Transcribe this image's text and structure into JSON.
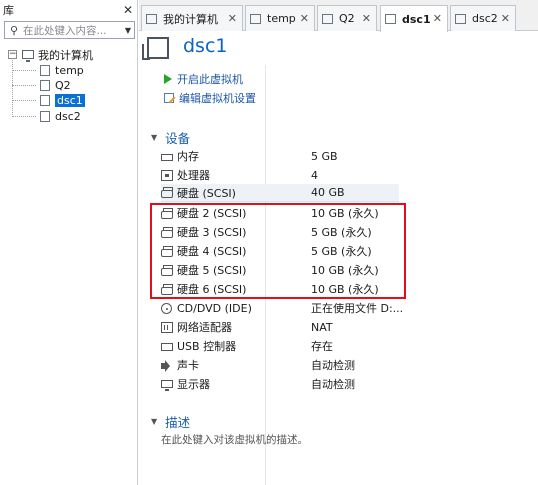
{
  "library": {
    "title": "库",
    "close": "✕",
    "search_placeholder": "在此处键入内容...",
    "tree": {
      "root": "我的计算机",
      "root_toggle": "⊟",
      "items": [
        {
          "label": "temp"
        },
        {
          "label": "Q2"
        },
        {
          "label": "dsc1",
          "selected": true
        },
        {
          "label": "dsc2"
        }
      ]
    }
  },
  "tabs": [
    {
      "label": "我的计算机",
      "active": false
    },
    {
      "label": "temp",
      "active": false
    },
    {
      "label": "Q2",
      "active": false
    },
    {
      "label": "dsc1",
      "active": true
    },
    {
      "label": "dsc2",
      "active": false
    }
  ],
  "tab_close": "✕",
  "vm": {
    "title": "dsc1",
    "actions": {
      "power_on": "开启此虚拟机",
      "edit_settings": "编辑虚拟机设置"
    }
  },
  "devices": {
    "section_title": "设备",
    "rows": [
      {
        "name": "内存",
        "value": "5 GB",
        "icon": "memory-icon"
      },
      {
        "name": "处理器",
        "value": "4",
        "icon": "processor-icon"
      },
      {
        "name": "硬盘 (SCSI)",
        "value": "40 GB",
        "icon": "hard-disk-icon"
      },
      {
        "name": "硬盘 2 (SCSI)",
        "value": "10 GB (永久)",
        "icon": "hard-disk-icon"
      },
      {
        "name": "硬盘 3 (SCSI)",
        "value": "5 GB (永久)",
        "icon": "hard-disk-icon"
      },
      {
        "name": "硬盘 4 (SCSI)",
        "value": "5 GB (永久)",
        "icon": "hard-disk-icon"
      },
      {
        "name": "硬盘 5 (SCSI)",
        "value": "10 GB (永久)",
        "icon": "hard-disk-icon"
      },
      {
        "name": "硬盘 6 (SCSI)",
        "value": "10 GB (永久)",
        "icon": "hard-disk-icon"
      },
      {
        "name": "CD/DVD (IDE)",
        "value": "正在使用文件 D:...",
        "icon": "cd-dvd-icon"
      },
      {
        "name": "网络适配器",
        "value": "NAT",
        "icon": "network-adapter-icon"
      },
      {
        "name": "USB 控制器",
        "value": "存在",
        "icon": "usb-icon"
      },
      {
        "name": "声卡",
        "value": "自动检测",
        "icon": "sound-card-icon"
      },
      {
        "name": "显示器",
        "value": "自动检测",
        "icon": "display-icon"
      }
    ]
  },
  "description": {
    "section_title": "描述",
    "placeholder": "在此处键入对该虚拟机的描述。"
  },
  "highlight_color": "#e0101a",
  "accent_color": "#0b63c4"
}
